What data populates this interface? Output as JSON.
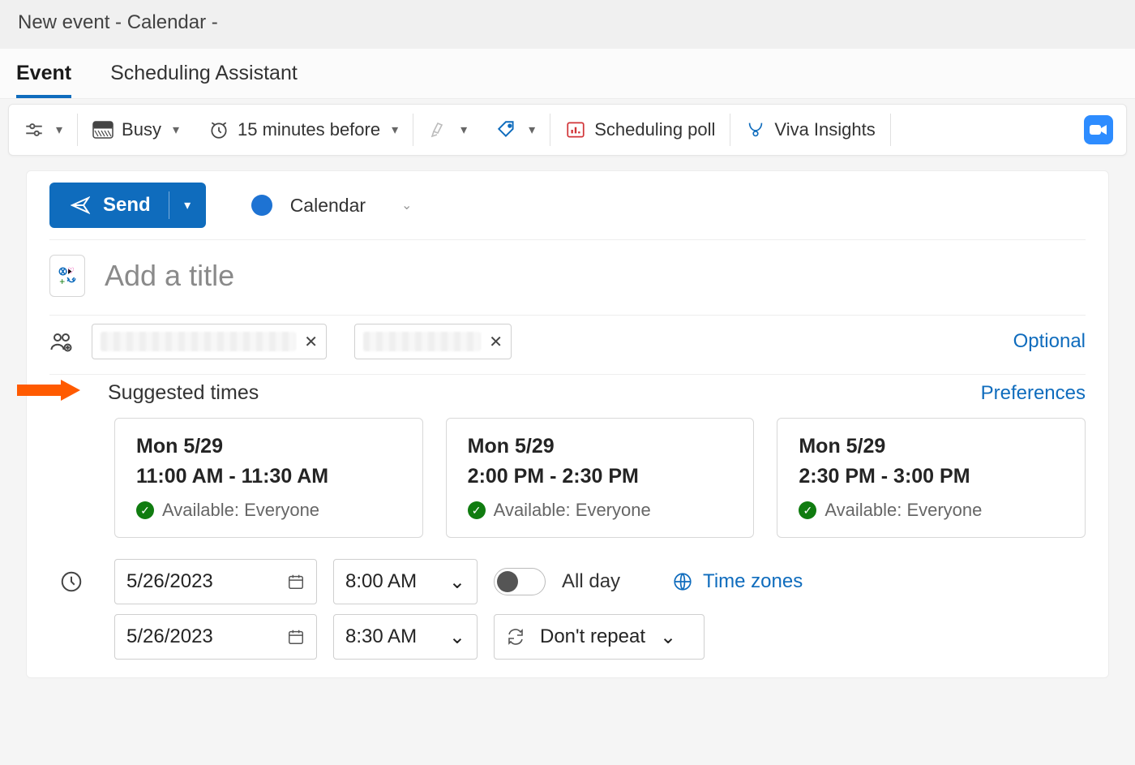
{
  "window": {
    "title": "New event - Calendar -"
  },
  "tabs": {
    "event": "Event",
    "sched": "Scheduling Assistant"
  },
  "toolbar": {
    "busy": "Busy",
    "reminder": "15 minutes before",
    "polls": "Scheduling poll",
    "viva": "Viva Insights"
  },
  "send": {
    "label": "Send"
  },
  "calendar_selector": {
    "label": "Calendar"
  },
  "title_placeholder": "Add a title",
  "attendees": {
    "optional_link": "Optional"
  },
  "suggested": {
    "heading": "Suggested times",
    "preferences": "Preferences",
    "cards": [
      {
        "date": "Mon 5/29",
        "time": "11:00 AM - 11:30 AM",
        "avail": "Available: Everyone"
      },
      {
        "date": "Mon 5/29",
        "time": "2:00 PM - 2:30 PM",
        "avail": "Available: Everyone"
      },
      {
        "date": "Mon 5/29",
        "time": "2:30 PM - 3:00 PM",
        "avail": "Available: Everyone"
      }
    ]
  },
  "datetime": {
    "start_date": "5/26/2023",
    "start_time": "8:00 AM",
    "end_date": "5/26/2023",
    "end_time": "8:30 AM",
    "all_day": "All day",
    "time_zones": "Time zones",
    "repeat": "Don't repeat"
  }
}
